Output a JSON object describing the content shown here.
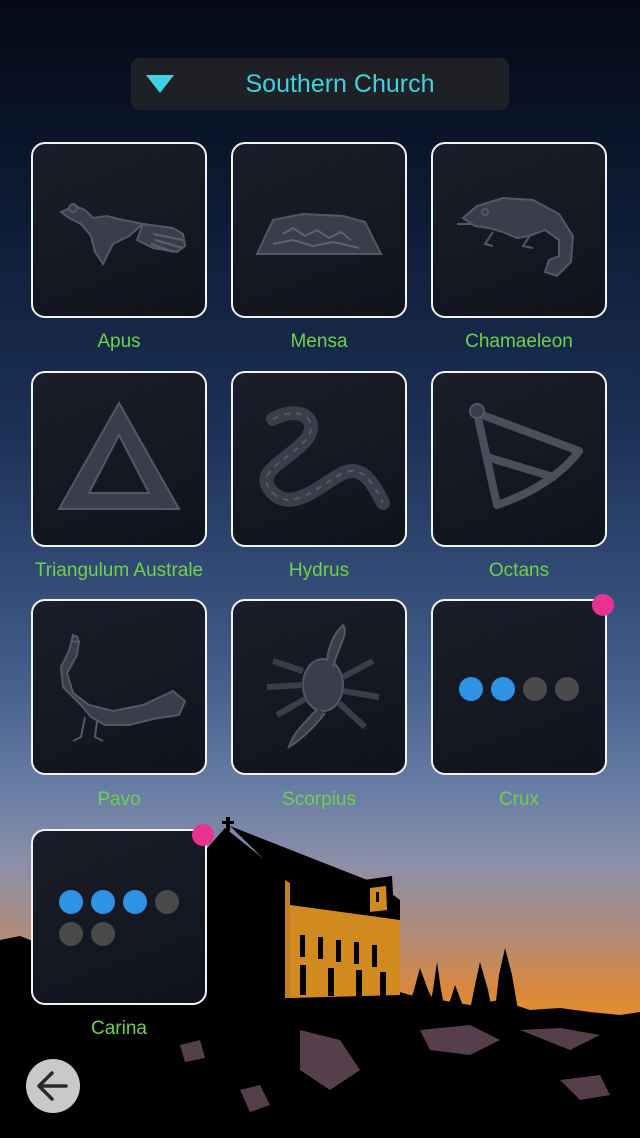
{
  "header": {
    "title": "Southern Church",
    "dropdown_icon": "triangle-down-icon",
    "accent": "#3fd3e0"
  },
  "tiles": [
    {
      "label": "Apus",
      "icon": "bird-of-paradise-icon"
    },
    {
      "label": "Mensa",
      "icon": "table-mountain-icon"
    },
    {
      "label": "Chamaeleon",
      "icon": "chameleon-icon"
    },
    {
      "label": "Triangulum Australe",
      "icon": "triangle-icon"
    },
    {
      "label": "Hydrus",
      "icon": "water-snake-icon"
    },
    {
      "label": "Octans",
      "icon": "octant-icon"
    },
    {
      "label": "Pavo",
      "icon": "peacock-icon"
    },
    {
      "label": "Scorpius",
      "icon": "scorpion-icon"
    },
    {
      "label": "Crux",
      "progress": {
        "filled": 2,
        "total": 4
      },
      "badge": true
    },
    {
      "label": "Carina",
      "progress": {
        "filled": 3,
        "total": 6
      },
      "badge": true
    }
  ],
  "colors": {
    "label": "#6fd24a",
    "badge": "#e6338d",
    "dot_on": "#2f93e4",
    "dot_off": "#4a4a4a"
  },
  "back_button": {
    "icon": "arrow-left-icon"
  }
}
